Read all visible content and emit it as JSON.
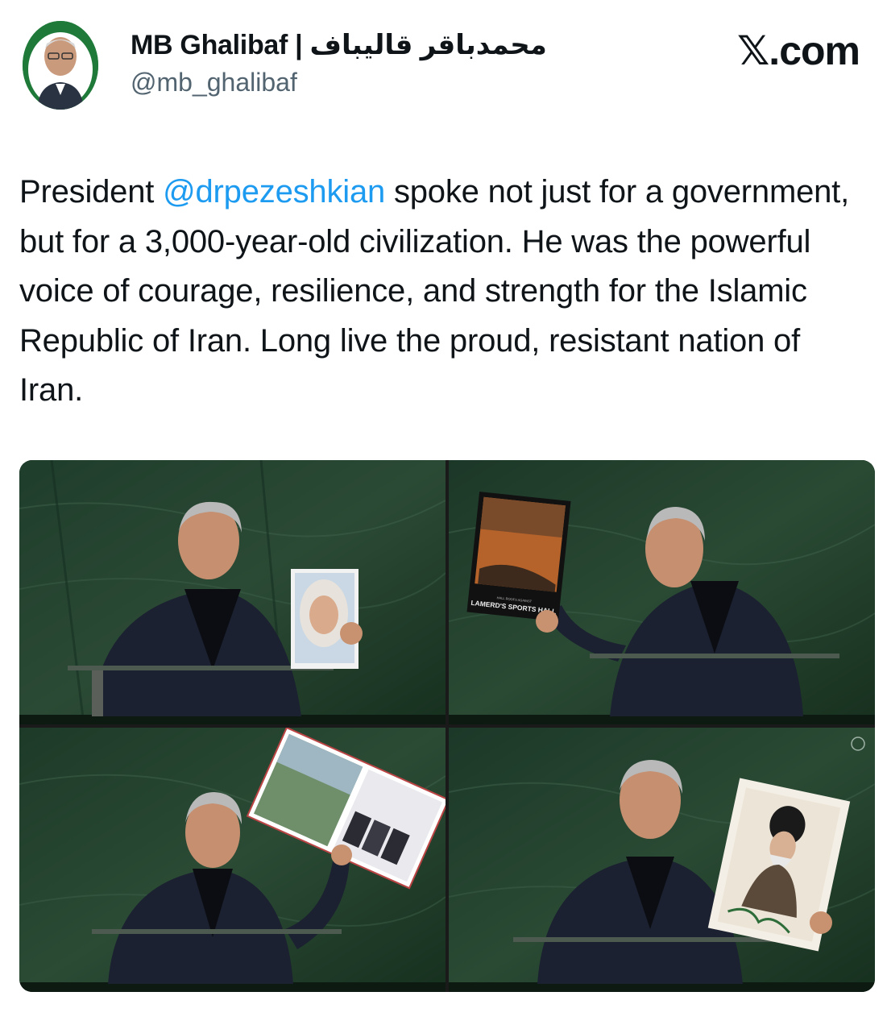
{
  "tweet": {
    "author": {
      "display_name": "MB Ghalibaf | محمدباقر قالیباف",
      "handle": "@mb_ghalibaf",
      "avatar_icon": "profile-photo-icon"
    },
    "brand": "𝕏.com",
    "text": {
      "part1": "President ",
      "mention": "@drpezeshkian",
      "part2": " spoke not just for a government, but for a 3,000-year-old civilization. He was the powerful voice of courage, resilience, and strength for the Islamic Republic of Iran. Long live the proud, resistant nation of Iran."
    },
    "media": {
      "photos": [
        {
          "name": "photo-portrait-girl"
        },
        {
          "name": "photo-sports-hall",
          "poster_caption": "LAMERD'S SPORTS HALL",
          "poster_small": "HALL ROOFS AGAINST"
        },
        {
          "name": "photo-book"
        },
        {
          "name": "photo-leader-portrait"
        }
      ]
    }
  },
  "colors": {
    "text": "#0f1419",
    "secondary_text": "#536471",
    "link": "#1d9bf0",
    "avatar_bg": "#1f7a3a",
    "marble": "#1e3a28"
  }
}
